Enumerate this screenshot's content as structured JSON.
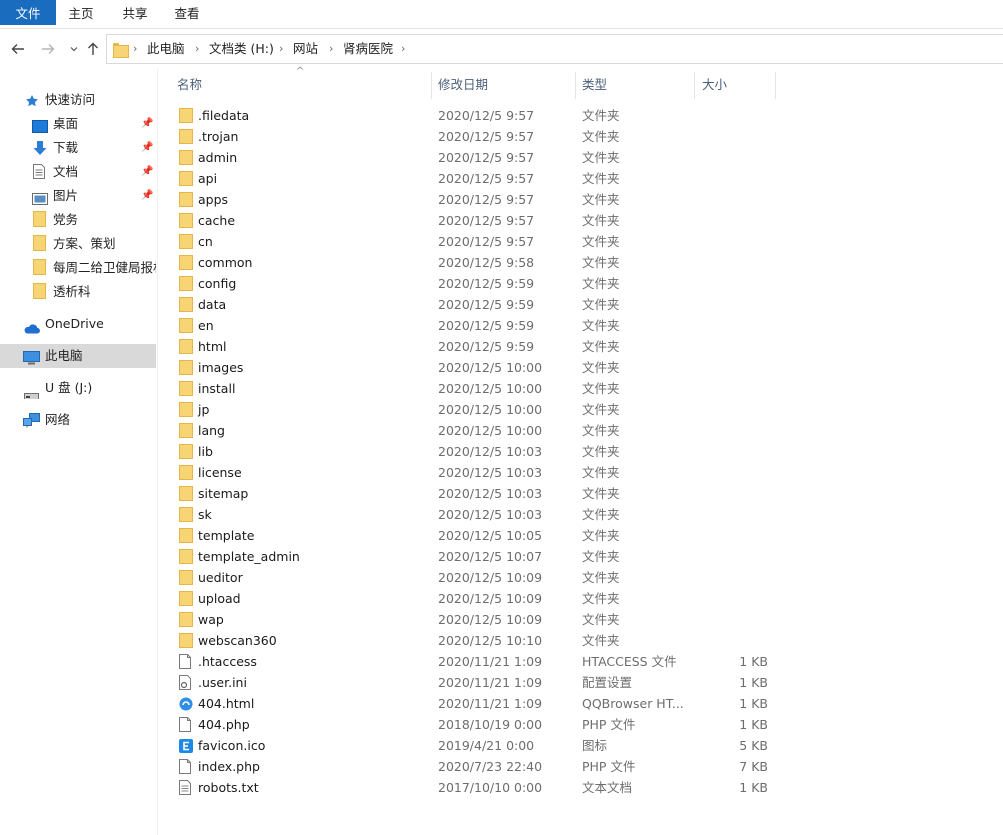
{
  "ribbon": {
    "tabs": [
      "文件",
      "主页",
      "共享",
      "查看"
    ]
  },
  "address": {
    "crumbs": [
      "此电脑",
      "文档类 (H:)",
      "网站",
      "肾病医院"
    ]
  },
  "sidebar": {
    "quick_access": "快速访问",
    "pinned": [
      {
        "label": "桌面",
        "icon": "desktop-icon"
      },
      {
        "label": "下载",
        "icon": "download-icon"
      },
      {
        "label": "文档",
        "icon": "document-icon"
      },
      {
        "label": "图片",
        "icon": "picture-icon"
      }
    ],
    "folders": [
      "党务",
      "方案、策划",
      "每周二给卫健局报材",
      "透析科"
    ],
    "onedrive": "OneDrive",
    "this_pc": "此电脑",
    "usb": "U 盘 (J:)",
    "network": "网络"
  },
  "columns": {
    "name": "名称",
    "date": "修改日期",
    "type": "类型",
    "size": "大小"
  },
  "files": [
    {
      "name": ".filedata",
      "date": "2020/12/5 9:57",
      "type": "文件夹",
      "size": "",
      "icon": "folder-icon"
    },
    {
      "name": ".trojan",
      "date": "2020/12/5 9:57",
      "type": "文件夹",
      "size": "",
      "icon": "folder-icon"
    },
    {
      "name": "admin",
      "date": "2020/12/5 9:57",
      "type": "文件夹",
      "size": "",
      "icon": "folder-icon"
    },
    {
      "name": "api",
      "date": "2020/12/5 9:57",
      "type": "文件夹",
      "size": "",
      "icon": "folder-icon"
    },
    {
      "name": "apps",
      "date": "2020/12/5 9:57",
      "type": "文件夹",
      "size": "",
      "icon": "folder-icon"
    },
    {
      "name": "cache",
      "date": "2020/12/5 9:57",
      "type": "文件夹",
      "size": "",
      "icon": "folder-icon"
    },
    {
      "name": "cn",
      "date": "2020/12/5 9:57",
      "type": "文件夹",
      "size": "",
      "icon": "folder-icon"
    },
    {
      "name": "common",
      "date": "2020/12/5 9:58",
      "type": "文件夹",
      "size": "",
      "icon": "folder-icon"
    },
    {
      "name": "config",
      "date": "2020/12/5 9:59",
      "type": "文件夹",
      "size": "",
      "icon": "folder-icon"
    },
    {
      "name": "data",
      "date": "2020/12/5 9:59",
      "type": "文件夹",
      "size": "",
      "icon": "folder-icon"
    },
    {
      "name": "en",
      "date": "2020/12/5 9:59",
      "type": "文件夹",
      "size": "",
      "icon": "folder-icon"
    },
    {
      "name": "html",
      "date": "2020/12/5 9:59",
      "type": "文件夹",
      "size": "",
      "icon": "folder-icon"
    },
    {
      "name": "images",
      "date": "2020/12/5 10:00",
      "type": "文件夹",
      "size": "",
      "icon": "folder-icon"
    },
    {
      "name": "install",
      "date": "2020/12/5 10:00",
      "type": "文件夹",
      "size": "",
      "icon": "folder-icon"
    },
    {
      "name": "jp",
      "date": "2020/12/5 10:00",
      "type": "文件夹",
      "size": "",
      "icon": "folder-icon"
    },
    {
      "name": "lang",
      "date": "2020/12/5 10:00",
      "type": "文件夹",
      "size": "",
      "icon": "folder-icon"
    },
    {
      "name": "lib",
      "date": "2020/12/5 10:03",
      "type": "文件夹",
      "size": "",
      "icon": "folder-icon"
    },
    {
      "name": "license",
      "date": "2020/12/5 10:03",
      "type": "文件夹",
      "size": "",
      "icon": "folder-icon"
    },
    {
      "name": "sitemap",
      "date": "2020/12/5 10:03",
      "type": "文件夹",
      "size": "",
      "icon": "folder-icon"
    },
    {
      "name": "sk",
      "date": "2020/12/5 10:03",
      "type": "文件夹",
      "size": "",
      "icon": "folder-icon"
    },
    {
      "name": "template",
      "date": "2020/12/5 10:05",
      "type": "文件夹",
      "size": "",
      "icon": "folder-icon"
    },
    {
      "name": "template_admin",
      "date": "2020/12/5 10:07",
      "type": "文件夹",
      "size": "",
      "icon": "folder-icon"
    },
    {
      "name": "ueditor",
      "date": "2020/12/5 10:09",
      "type": "文件夹",
      "size": "",
      "icon": "folder-icon"
    },
    {
      "name": "upload",
      "date": "2020/12/5 10:09",
      "type": "文件夹",
      "size": "",
      "icon": "folder-icon"
    },
    {
      "name": "wap",
      "date": "2020/12/5 10:09",
      "type": "文件夹",
      "size": "",
      "icon": "folder-icon"
    },
    {
      "name": "webscan360",
      "date": "2020/12/5 10:10",
      "type": "文件夹",
      "size": "",
      "icon": "folder-icon"
    },
    {
      "name": ".htaccess",
      "date": "2020/11/21 1:09",
      "type": "HTACCESS 文件",
      "size": "1 KB",
      "icon": "file-icon"
    },
    {
      "name": ".user.ini",
      "date": "2020/11/21 1:09",
      "type": "配置设置",
      "size": "1 KB",
      "icon": "settings-file-icon"
    },
    {
      "name": "404.html",
      "date": "2020/11/21 1:09",
      "type": "QQBrowser HT...",
      "size": "1 KB",
      "icon": "browser-file-icon"
    },
    {
      "name": "404.php",
      "date": "2018/10/19 0:00",
      "type": "PHP 文件",
      "size": "1 KB",
      "icon": "file-icon"
    },
    {
      "name": "favicon.ico",
      "date": "2019/4/21 0:00",
      "type": "图标",
      "size": "5 KB",
      "icon": "favicon-icon"
    },
    {
      "name": "index.php",
      "date": "2020/7/23 22:40",
      "type": "PHP 文件",
      "size": "7 KB",
      "icon": "file-icon"
    },
    {
      "name": "robots.txt",
      "date": "2017/10/10 0:00",
      "type": "文本文档",
      "size": "1 KB",
      "icon": "text-file-icon"
    }
  ],
  "colors": {
    "ribbon_file_tab": "#1a6cbf",
    "folder": "#f7d474",
    "header_text": "#4c607a",
    "selected": "#d9d9d9"
  }
}
